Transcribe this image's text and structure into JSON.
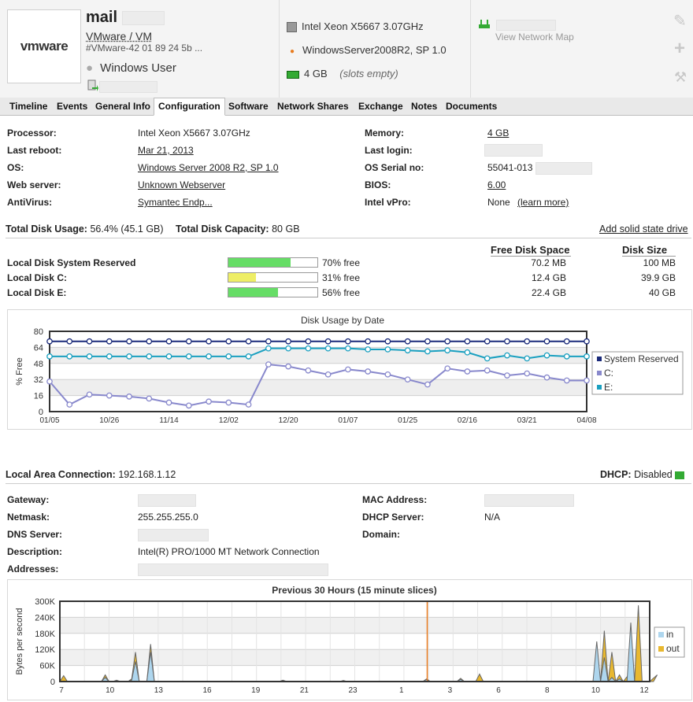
{
  "header": {
    "logo_text": "vmware",
    "hostname": "mail",
    "vendor": "VMware / VM",
    "serial": "#VMware-42 01 89 24 5b ...",
    "user": "Windows User",
    "cpu": "Intel Xeon X5667 3.07GHz",
    "os": "WindowsServer2008R2, SP 1.0",
    "memory": "4 GB",
    "memory_note": "(slots empty)",
    "network_map": "View Network Map"
  },
  "tabs": [
    "Timeline",
    "Events",
    "General Info",
    "Configuration",
    "Software",
    "Network Shares",
    "Exchange",
    "Notes",
    "Documents"
  ],
  "info": {
    "processor_label": "Processor:",
    "processor": "Intel Xeon X5667 3.07GHz",
    "reboot_label": "Last reboot:",
    "reboot": "Mar 21, 2013",
    "os_label": "OS:",
    "os": "Windows Server 2008 R2, SP 1.0",
    "web_label": "Web server:",
    "web": "Unknown Webserver",
    "av_label": "AntiVirus:",
    "av": "Symantec Endp...",
    "memory_label": "Memory:",
    "memory": "4 GB",
    "login_label": "Last login:",
    "serial_label": "OS Serial no:",
    "serial": "55041-013",
    "bios_label": "BIOS:",
    "bios": "6.00",
    "vpro_label": "Intel  vPro:",
    "vpro": "None",
    "vpro_link": "(learn more)"
  },
  "disk": {
    "usage_label": "Total Disk Usage:",
    "usage": "56.4% (45.1 GB)",
    "capacity_label": "Total Disk Capacity:",
    "capacity": "80 GB",
    "add_ssd": "Add solid state drive",
    "col_free": "Free Disk Space",
    "col_size": "Disk Size",
    "rows": [
      {
        "name": "Local Disk System Reserved",
        "pct": 0.7,
        "pct_text": "70% free",
        "free": "70.2 MB",
        "size": "100 MB",
        "color": "#66dd66"
      },
      {
        "name": "Local Disk C:",
        "pct": 0.31,
        "pct_text": "31% free",
        "free": "12.4 GB",
        "size": "39.9 GB",
        "color": "#eeee66"
      },
      {
        "name": "Local Disk E:",
        "pct": 0.56,
        "pct_text": "56% free",
        "free": "22.4 GB",
        "size": "40 GB",
        "color": "#66dd66"
      }
    ]
  },
  "network": {
    "conn_label": "Local Area Connection:",
    "conn_ip": "192.168.1.12",
    "dhcp_label": "DHCP:",
    "dhcp": "Disabled",
    "gateway_label": "Gateway:",
    "netmask_label": "Netmask:",
    "netmask": "255.255.255.0",
    "dns_label": "DNS Server:",
    "desc_label": "Description:",
    "desc": "Intel(R) PRO/1000 MT Network Connection",
    "addr_label": "Addresses:",
    "mac_label": "MAC Address:",
    "dhcp_server_label": "DHCP Server:",
    "dhcp_server": "N/A",
    "domain_label": "Domain:"
  },
  "chart_data": [
    {
      "type": "line",
      "title": "Disk Usage by Date",
      "ylabel": "% Free",
      "ylim": [
        0,
        80
      ],
      "yticks": [
        0,
        16,
        32,
        48,
        64,
        80
      ],
      "xtick_labels": [
        "01/05",
        "10/26",
        "11/14",
        "12/02",
        "12/20",
        "01/07",
        "01/25",
        "02/16",
        "03/21",
        "04/08"
      ],
      "legend_position": "right",
      "series": [
        {
          "name": "System Reserved",
          "color": "#1a2a7a",
          "values": [
            70,
            70,
            70,
            70,
            70,
            70,
            70,
            70,
            70,
            70,
            70,
            70,
            70,
            70,
            70,
            70,
            70,
            70,
            70,
            70,
            70,
            70,
            70,
            70,
            70,
            70,
            70,
            70
          ]
        },
        {
          "name": "C:",
          "color": "#8888cc",
          "values": [
            30,
            7,
            17,
            16,
            15,
            13,
            9,
            6,
            10,
            9,
            7,
            47,
            45,
            41,
            37,
            42,
            40,
            37,
            32,
            27,
            43,
            40,
            41,
            36,
            38,
            34,
            31,
            31
          ]
        },
        {
          "name": "E:",
          "color": "#1aa0c0",
          "values": [
            55,
            55,
            55,
            55,
            55,
            55,
            55,
            55,
            55,
            55,
            55,
            63,
            63,
            63,
            63,
            63,
            62,
            62,
            61,
            60,
            61,
            59,
            53,
            56,
            53,
            56,
            55,
            55
          ]
        }
      ]
    },
    {
      "type": "area",
      "title": "Previous 30 Hours (15 minute slices)",
      "ylabel": "Bytes per second",
      "ylim": [
        0,
        300000
      ],
      "yticks": [
        "0",
        "60K",
        "120K",
        "180K",
        "240K",
        "300K"
      ],
      "xtick_labels": [
        "7",
        "10",
        "13",
        "16",
        "19",
        "21",
        "23",
        "1",
        "3",
        "6",
        "8",
        "10",
        "12"
      ],
      "legend_position": "right",
      "series": [
        {
          "name": "in",
          "color": "#aed6ee",
          "values": [
            0,
            2000,
            0,
            0,
            0,
            0,
            0,
            0,
            0,
            0,
            0,
            0,
            15000,
            0,
            0,
            3000,
            0,
            0,
            0,
            5000,
            75000,
            0,
            0,
            0,
            110000,
            0,
            0,
            0,
            0,
            0,
            0,
            0,
            0,
            0,
            0,
            0,
            0,
            0,
            0,
            0,
            0,
            0,
            0,
            0,
            0,
            0,
            0,
            0,
            0,
            0,
            0,
            0,
            0,
            0,
            0,
            0,
            0,
            0,
            0,
            3000,
            0,
            0,
            0,
            0,
            0,
            0,
            0,
            0,
            0,
            0,
            0,
            0,
            0,
            0,
            0,
            2000,
            0,
            0,
            0,
            0,
            0,
            0,
            0,
            0,
            0,
            0,
            0,
            0,
            0,
            0,
            0,
            0,
            0,
            0,
            0,
            0,
            0,
            8000,
            0,
            0,
            0,
            0,
            0,
            0,
            0,
            0,
            8000,
            0,
            0,
            0,
            0,
            0,
            0,
            0,
            0,
            0,
            0,
            0,
            0,
            0,
            0,
            0,
            0,
            0,
            0,
            0,
            0,
            0,
            0,
            0,
            0,
            0,
            0,
            0,
            0,
            0,
            0,
            0,
            0,
            0,
            0,
            0,
            150000,
            0,
            90000,
            0,
            15000,
            0,
            10000,
            0,
            0,
            220000,
            0,
            0,
            0,
            0,
            0
          ]
        },
        {
          "name": "out",
          "color": "#e8b830",
          "values": [
            0,
            22000,
            0,
            0,
            0,
            0,
            0,
            0,
            0,
            0,
            0,
            0,
            25000,
            0,
            0,
            5000,
            0,
            0,
            0,
            10000,
            110000,
            0,
            0,
            0,
            140000,
            0,
            0,
            0,
            0,
            0,
            0,
            0,
            0,
            0,
            0,
            0,
            0,
            0,
            0,
            0,
            0,
            0,
            0,
            0,
            0,
            0,
            0,
            0,
            0,
            0,
            0,
            0,
            0,
            0,
            0,
            0,
            0,
            0,
            0,
            5000,
            0,
            0,
            0,
            0,
            0,
            0,
            0,
            0,
            0,
            0,
            0,
            0,
            0,
            0,
            0,
            4000,
            0,
            0,
            0,
            0,
            0,
            0,
            0,
            0,
            0,
            0,
            0,
            0,
            0,
            0,
            0,
            0,
            0,
            0,
            0,
            0,
            0,
            10000,
            0,
            0,
            0,
            0,
            0,
            0,
            0,
            0,
            12000,
            0,
            0,
            0,
            0,
            28000,
            0,
            0,
            0,
            0,
            0,
            0,
            0,
            0,
            0,
            0,
            0,
            0,
            0,
            0,
            0,
            0,
            0,
            0,
            0,
            0,
            0,
            0,
            0,
            0,
            0,
            0,
            0,
            0,
            0,
            0,
            0,
            0,
            190000,
            0,
            110000,
            0,
            25000,
            0,
            18000,
            0,
            0,
            285000,
            0,
            0,
            0,
            0,
            25000
          ]
        }
      ]
    }
  ]
}
